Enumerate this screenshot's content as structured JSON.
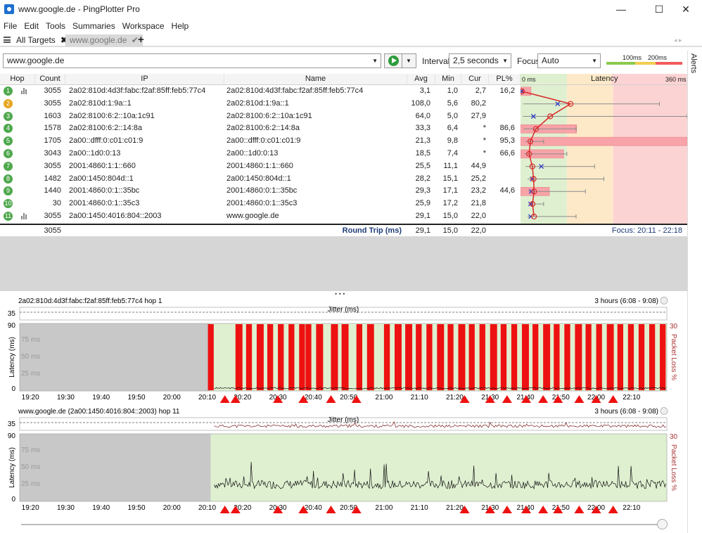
{
  "window": {
    "title": "www.google.de - PingPlotter Pro",
    "min": "—",
    "max": "☐",
    "close": "✕"
  },
  "menu": [
    "File",
    "Edit",
    "Tools",
    "Summaries",
    "Workspace",
    "Help"
  ],
  "tabs": {
    "all": "All Targets",
    "target": "www.google.de",
    "add": "+"
  },
  "toolbar": {
    "target": "www.google.de",
    "interval_label": "Interval",
    "interval_value": "2,5 seconds",
    "focus_label": "Focus",
    "focus_value": "Auto",
    "legend_100": "100ms",
    "legend_200": "200ms"
  },
  "table": {
    "headers": {
      "hop": "Hop",
      "count": "Count",
      "ip": "IP",
      "name": "Name",
      "avg": "Avg",
      "min": "Min",
      "cur": "Cur",
      "pl": "PL%",
      "zero": "0 ms",
      "latency": "Latency",
      "max": "360 ms"
    },
    "rows": [
      {
        "hop": "1",
        "count": "3055",
        "ip": "2a02:810d:4d3f:fabc:f2af:85ff:feb5:77c4",
        "name": "2a02:810d:4d3f:fabc:f2af:85ff:feb5:77c4",
        "avg": "3,1",
        "min": "1,0",
        "cur": "2,7",
        "pl": "16,2",
        "plv": 16.2,
        "avgv": 3.1,
        "minv": 1.0,
        "curv": 2.7,
        "maxv": 3,
        "status": "green",
        "chart": true
      },
      {
        "hop": "2",
        "count": "3055",
        "ip": "2a02:810d:1:9a::1",
        "name": "2a02:810d:1:9a::1",
        "avg": "108,0",
        "min": "5,6",
        "cur": "80,2",
        "pl": "",
        "plv": 0,
        "avgv": 108,
        "minv": 5.6,
        "curv": 80.2,
        "maxv": 300,
        "status": "yellow",
        "chart": false
      },
      {
        "hop": "3",
        "count": "1603",
        "ip": "2a02:8100:6:2::10a:1c91",
        "name": "2a02:8100:6:2::10a:1c91",
        "avg": "64,0",
        "min": "5,0",
        "cur": "27,9",
        "pl": "",
        "plv": 0,
        "avgv": 64,
        "minv": 5,
        "curv": 27.9,
        "maxv": 360,
        "status": "green",
        "chart": false
      },
      {
        "hop": "4",
        "count": "1578",
        "ip": "2a02:8100:6:2::14:8a",
        "name": "2a02:8100:6:2::14:8a",
        "avg": "33,3",
        "min": "6,4",
        "cur": "*",
        "pl": "86,6",
        "plv": 86.6,
        "avgv": 33.3,
        "minv": 6.4,
        "curv": null,
        "maxv": 120,
        "status": "green",
        "chart": false
      },
      {
        "hop": "5",
        "count": "1705",
        "ip": "2a00::dfff:0:c01:c01:9",
        "name": "2a00::dfff:0:c01:c01:9",
        "avg": "21,3",
        "min": "9,8",
        "cur": "*",
        "pl": "95,3",
        "plv": 95.3,
        "avgv": 21.3,
        "minv": 9.8,
        "curv": null,
        "maxv": 50,
        "status": "green",
        "chart": false
      },
      {
        "hop": "6",
        "count": "3043",
        "ip": "2a00::1d0:0:13",
        "name": "2a00::1d0:0:13",
        "avg": "18,5",
        "min": "7,4",
        "cur": "*",
        "pl": "66,6",
        "plv": 66.6,
        "avgv": 18.5,
        "minv": 7.4,
        "curv": null,
        "maxv": 100,
        "status": "green",
        "chart": false
      },
      {
        "hop": "7",
        "count": "3055",
        "ip": "2001:4860:1:1::660",
        "name": "2001:4860:1:1::660",
        "avg": "25,5",
        "min": "11,1",
        "cur": "44,9",
        "pl": "",
        "plv": 0,
        "avgv": 25.5,
        "minv": 11.1,
        "curv": 44.9,
        "maxv": 160,
        "status": "green",
        "chart": false
      },
      {
        "hop": "8",
        "count": "1482",
        "ip": "2a00:1450:804d::1",
        "name": "2a00:1450:804d::1",
        "avg": "28,2",
        "min": "15,1",
        "cur": "25,2",
        "pl": "",
        "plv": 0,
        "avgv": 28.2,
        "minv": 15.1,
        "curv": 25.2,
        "maxv": 180,
        "status": "green",
        "chart": false
      },
      {
        "hop": "9",
        "count": "1440",
        "ip": "2001:4860:0:1::35bc",
        "name": "2001:4860:0:1::35bc",
        "avg": "29,3",
        "min": "17,1",
        "cur": "23,2",
        "pl": "44,6",
        "plv": 44.6,
        "avgv": 29.3,
        "minv": 17.1,
        "curv": 23.2,
        "maxv": 140,
        "status": "green",
        "chart": false
      },
      {
        "hop": "10",
        "count": "30",
        "ip": "2001:4860:0:1::35c3",
        "name": "2001:4860:0:1::35c3",
        "avg": "25,9",
        "min": "17,2",
        "cur": "21,8",
        "pl": "",
        "plv": 0,
        "avgv": 25.9,
        "minv": 17.2,
        "curv": 21.8,
        "maxv": 50,
        "status": "green",
        "chart": false
      },
      {
        "hop": "11",
        "count": "3055",
        "ip": "2a00:1450:4016:804::2003",
        "name": "www.google.de",
        "avg": "29,1",
        "min": "15,0",
        "cur": "22,0",
        "pl": "",
        "plv": 0,
        "avgv": 29.1,
        "minv": 15,
        "curv": 22,
        "maxv": 120,
        "status": "green",
        "chart": true
      }
    ],
    "summary": {
      "count": "3055",
      "label": "Round Trip (ms)",
      "avg": "29,1",
      "min": "15,0",
      "cur": "22,0",
      "focus": "Focus: 20:11 - 22:18"
    },
    "scale_max_ms": 360
  },
  "dots": "• • •",
  "charts": [
    {
      "title": "2a02:810d:4d3f:fabc:f2af:85ff:feb5:77c4 hop 1",
      "range": "3 hours (6:08 - 9:08)",
      "jitter": "Jitter (ms)",
      "jitter_max": "35",
      "ylabel": "Latency (ms)",
      "yright": "Packet Loss %",
      "ymax": "90",
      "ymax_right": "30",
      "yticks": [
        "75 ms",
        "50 ms",
        "25 ms"
      ],
      "yzero": "0",
      "xticks": [
        "19:20",
        "19:30",
        "19:40",
        "19:50",
        "20:00",
        "20:10",
        "20:20",
        "20:30",
        "20:40",
        "20:50",
        "21:00",
        "21:10",
        "21:20",
        "21:30",
        "21:40",
        "21:50",
        "22:00",
        "22:10"
      ],
      "loss_bars": [
        [
          20.17,
          0.05
        ],
        [
          20.3,
          0.06
        ],
        [
          20.35,
          0.05
        ],
        [
          20.4,
          0.06
        ],
        [
          20.45,
          0.05
        ],
        [
          20.5,
          0.05
        ],
        [
          20.55,
          0.05
        ],
        [
          20.6,
          0.05
        ],
        [
          20.63,
          0.05
        ],
        [
          20.68,
          0.06
        ],
        [
          20.75,
          0.06
        ],
        [
          20.8,
          0.06
        ],
        [
          20.87,
          0.05
        ],
        [
          20.92,
          0.06
        ],
        [
          21.0,
          0.05
        ],
        [
          21.05,
          0.06
        ],
        [
          21.1,
          0.06
        ],
        [
          21.15,
          0.05
        ],
        [
          21.2,
          0.05
        ],
        [
          21.25,
          0.06
        ],
        [
          21.3,
          0.05
        ],
        [
          21.35,
          0.06
        ],
        [
          21.4,
          0.05
        ],
        [
          21.45,
          0.05
        ],
        [
          21.5,
          0.06
        ],
        [
          21.55,
          0.05
        ],
        [
          21.6,
          0.05
        ],
        [
          21.65,
          0.06
        ],
        [
          21.7,
          0.05
        ],
        [
          21.75,
          0.06
        ],
        [
          21.8,
          0.05
        ],
        [
          21.85,
          0.05
        ],
        [
          21.9,
          0.06
        ],
        [
          21.95,
          0.05
        ],
        [
          22.0,
          0.05
        ],
        [
          22.05,
          0.06
        ],
        [
          22.1,
          0.05
        ],
        [
          22.15,
          0.05
        ],
        [
          22.2,
          0.05
        ],
        [
          22.25,
          0.05
        ],
        [
          22.3,
          0.05
        ]
      ],
      "markers": [
        20.25,
        20.3,
        20.5,
        20.62,
        20.75,
        20.87,
        21.38,
        21.5,
        21.58,
        21.67,
        21.75,
        21.82,
        21.92,
        22.0,
        22.08
      ],
      "bars": true
    },
    {
      "title": "www.google.de (2a00:1450:4016:804::2003) hop 11",
      "range": "3 hours (6:08 - 9:08)",
      "jitter": "Jitter (ms)",
      "jitter_max": "35",
      "ylabel": "Latency (ms)",
      "yright": "Packet Loss %",
      "ymax": "90",
      "ymax_right": "30",
      "yticks": [
        "75 ms",
        "50 ms",
        "25 ms"
      ],
      "yzero": "0",
      "xticks": [
        "19:20",
        "19:30",
        "19:40",
        "19:50",
        "20:00",
        "20:10",
        "20:20",
        "20:30",
        "20:40",
        "20:50",
        "21:00",
        "21:10",
        "21:20",
        "21:30",
        "21:40",
        "21:50",
        "22:00",
        "22:10"
      ],
      "markers": [
        20.25,
        20.3,
        20.5,
        20.62,
        20.75,
        20.87,
        21.38,
        21.5,
        21.58,
        21.67,
        21.75,
        21.82,
        21.92,
        22.0,
        22.08
      ],
      "bars": false
    }
  ],
  "alerts": "Alerts",
  "colors": {
    "green": "#4fa84d",
    "yellow": "#e6a51f",
    "red": "#ee1111",
    "bg_green": "#dff0d0",
    "bg_yellow": "#fde9c8",
    "bg_red": "#fcd3d3"
  }
}
